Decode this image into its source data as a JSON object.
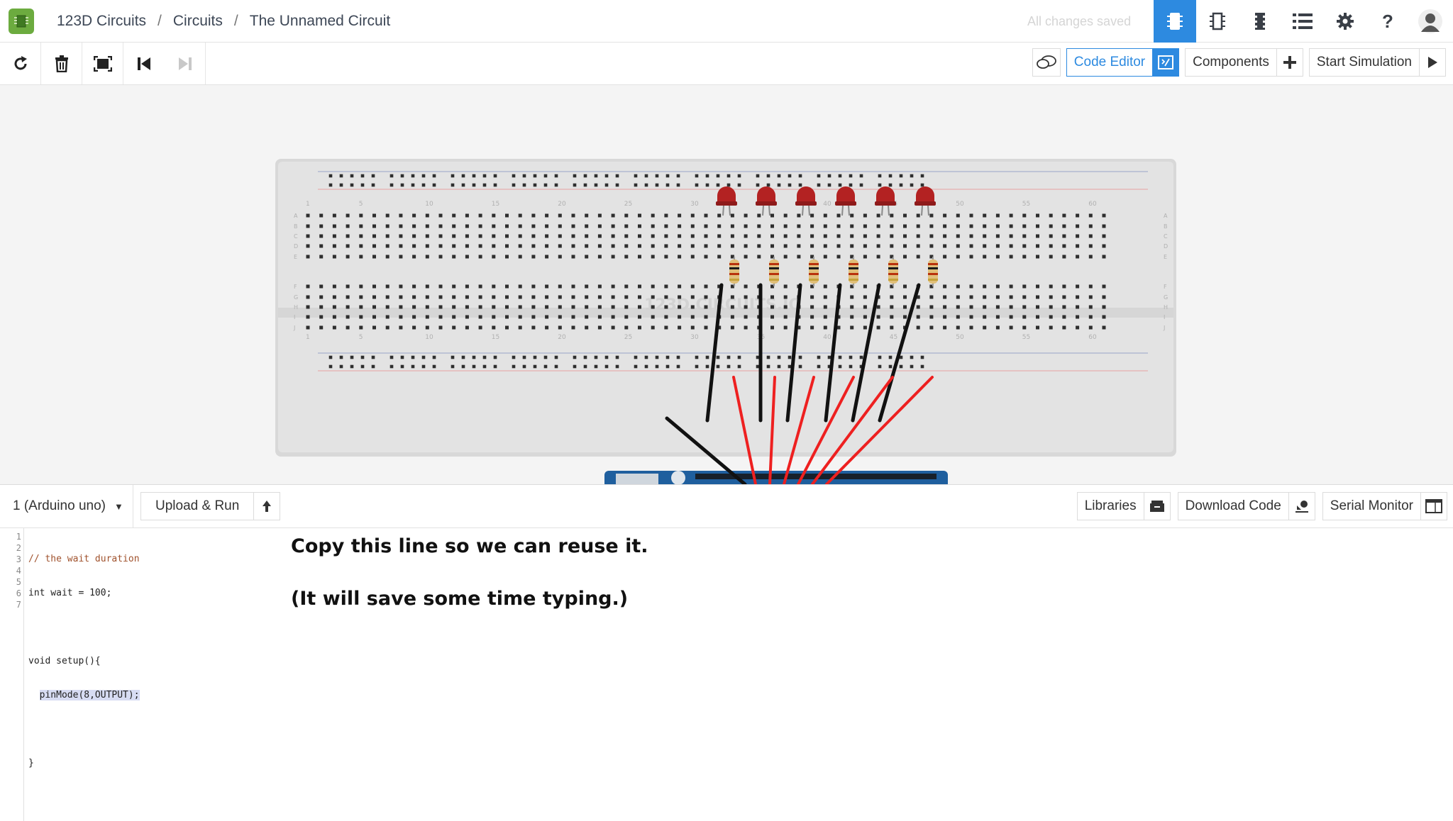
{
  "header": {
    "breadcrumbs": [
      "123D Circuits",
      "Circuits",
      "The Unnamed Circuit"
    ],
    "separator": "/",
    "save_status": "All changes saved",
    "icons": [
      "breadboard-view-icon",
      "schematic-view-icon",
      "pcb-view-icon",
      "component-list-icon",
      "settings-icon",
      "help-icon",
      "user-avatar-icon"
    ],
    "help_glyph": "?"
  },
  "toolbar": {
    "left_tools": [
      "rotate-icon",
      "delete-icon",
      "fit-to-screen-icon",
      "step-back-icon",
      "step-forward-icon"
    ],
    "comment_icon": "speech-bubble-icon",
    "code_editor_label": "Code Editor",
    "components_label": "Components",
    "start_simulation_label": "Start Simulation"
  },
  "canvas": {
    "watermark": "123D.CIRCUITS.IO",
    "column_labels_top": [
      "1",
      "5",
      "10",
      "15",
      "20",
      "25",
      "30",
      "35",
      "40",
      "45",
      "50",
      "55",
      "60"
    ],
    "row_labels_upper": [
      "A",
      "B",
      "C",
      "D",
      "E"
    ],
    "row_labels_lower": [
      "F",
      "G",
      "H",
      "I",
      "J"
    ],
    "led_count": 6,
    "resistor_count": 6,
    "colors": {
      "led": "#b32222",
      "wire_black": "#111111",
      "wire_red": "#ee2020",
      "arduino": "#1f5f9e"
    }
  },
  "codebar": {
    "board": "1 (Arduino uno)",
    "upload_label": "Upload & Run",
    "libraries_label": "Libraries",
    "download_label": "Download Code",
    "serial_label": "Serial Monitor"
  },
  "editor": {
    "line_numbers": [
      "1",
      "2",
      "3",
      "4",
      "5",
      "6",
      "7"
    ],
    "lines": [
      "// the wait duration",
      "int wait = 100;",
      "",
      "void setup(){",
      "  pinMode(8,OUTPUT);",
      "",
      "}"
    ]
  },
  "instructions": {
    "line1": "Copy this line so we can reuse it.",
    "line2": "(It will save some time typing.)"
  }
}
